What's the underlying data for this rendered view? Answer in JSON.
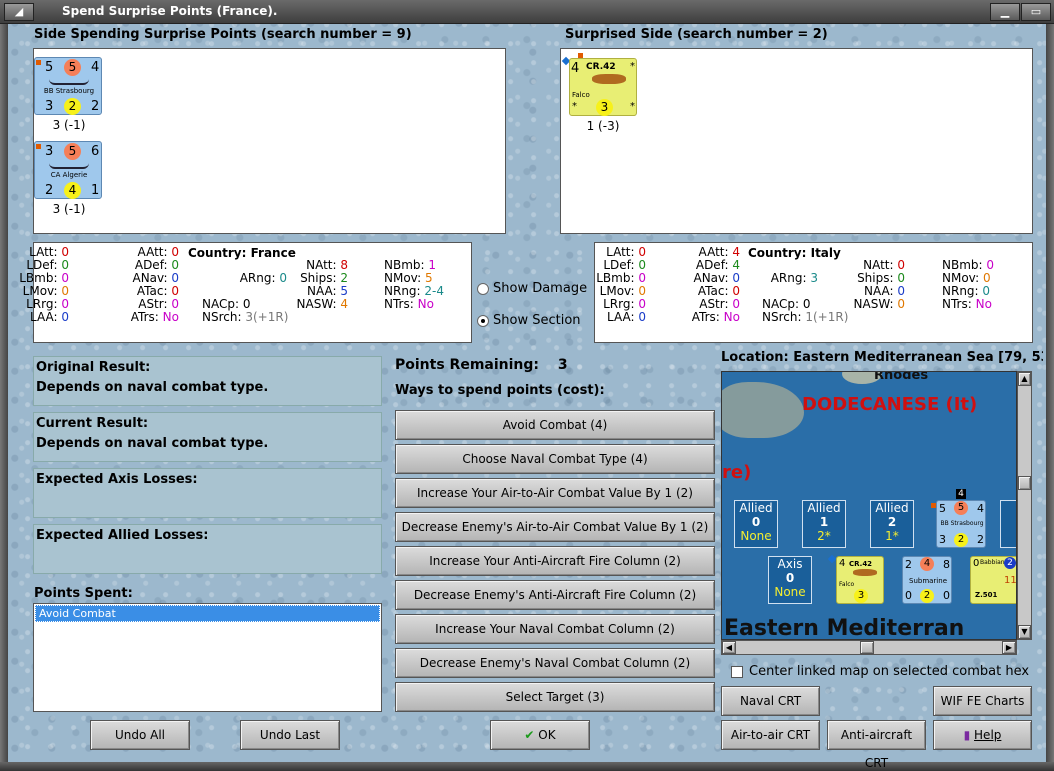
{
  "window": {
    "title": "Spend Surprise Points (France)."
  },
  "spending": {
    "header": "Side Spending Surprise Points (search number = 9)",
    "units": [
      {
        "top_left": "5",
        "top_mid": "5",
        "top_right": "4",
        "name": "BB Strasbourg",
        "bot_left": "3",
        "bot_mid": "2",
        "bot_right": "2",
        "caption": "3 (-1)"
      },
      {
        "top_left": "3",
        "top_mid": "5",
        "top_right": "6",
        "name": "CA Algerie",
        "bot_left": "2",
        "bot_mid": "4",
        "bot_right": "1",
        "caption": "3 (-1)"
      }
    ]
  },
  "surprised": {
    "header": "Surprised Side (search number = 2)",
    "units": [
      {
        "top_left": "4",
        "name": "CR.42",
        "sub": "Falco",
        "star_tr": "*",
        "star_bl": "*",
        "star_br": "*",
        "mid": "3",
        "caption": "1 (-3)"
      }
    ]
  },
  "stats_labels": {
    "latt": "LAtt:",
    "ldef": "LDef:",
    "lbmb": "LBmb:",
    "lmov": "LMov:",
    "lrrg": "LRrg:",
    "laa": "LAA:",
    "aatt": "AAtt:",
    "adef": "ADef:",
    "anav": "ANav:",
    "atac": "ATac:",
    "astr": "AStr:",
    "atrs": "ATrs:",
    "country": "Country:",
    "arng": "ARng:",
    "nacp": "NACp:",
    "nsrch": "NSrch:",
    "natt": "NAtt:",
    "ships": "Ships:",
    "naa": "NAA:",
    "nasw": "NASW:",
    "nbmb": "NBmb:",
    "nmov": "NMov:",
    "nrng": "NRng:",
    "ntrs": "NTrs:"
  },
  "stats_france": {
    "latt": "0",
    "ldef": "0",
    "lbmb": "0",
    "lmov": "0",
    "lrrg": "0",
    "laa": "0",
    "aatt": "0",
    "adef": "0",
    "anav": "0",
    "atac": "0",
    "astr": "0",
    "atrs": "No",
    "country": "France",
    "arng": "0",
    "nacp": "0",
    "nsrch": "3(+1R)",
    "natt": "8",
    "ships": "2",
    "naa": "5",
    "nasw": "4",
    "nbmb": "1",
    "nmov": "5",
    "nrng": "2-4",
    "ntrs": "No"
  },
  "stats_italy": {
    "latt": "0",
    "ldef": "0",
    "lbmb": "0",
    "lmov": "0",
    "lrrg": "0",
    "laa": "0",
    "aatt": "4",
    "adef": "4",
    "anav": "0",
    "atac": "0",
    "astr": "0",
    "atrs": "No",
    "country": "Italy",
    "arng": "3",
    "nacp": "0",
    "nsrch": "1(+1R)",
    "natt": "0",
    "ships": "0",
    "naa": "0",
    "nasw": "0",
    "nbmb": "0",
    "nmov": "0",
    "nrng": "0",
    "ntrs": "No"
  },
  "options": {
    "show_damage": "Show Damage",
    "show_section": "Show Section",
    "selected": "show_section"
  },
  "results": {
    "original_label": "Original Result:",
    "original_value": "Depends on naval combat type.",
    "current_label": "Current Result:",
    "current_value": "Depends on naval combat type.",
    "axis_losses_label": "Expected Axis Losses:",
    "allied_losses_label": "Expected Allied Losses:",
    "points_spent_label": "Points Spent:",
    "points_spent_items": [
      "Avoid Combat"
    ]
  },
  "points": {
    "remaining_label": "Points Remaining:",
    "remaining_value": "3",
    "ways_label": "Ways to spend points (cost):",
    "options": [
      "Avoid Combat (4)",
      "Choose Naval Combat Type (4)",
      "Increase Your Air-to-Air Combat Value By 1 (2)",
      "Decrease Enemy's Air-to-Air Combat Value By 1 (2)",
      "Increase Your Anti-Aircraft Fire Column (2)",
      "Decrease Enemy's Anti-Aircraft Fire Column (2)",
      "Increase Your Naval Combat Column (2)",
      "Decrease Enemy's Naval Combat Column (2)",
      "Select Target (3)"
    ]
  },
  "map": {
    "location": "Location: Eastern Mediterranean Sea [79, 53",
    "place_rhodes": "Rhodes",
    "region": "DODECANESE (It)",
    "fragment": "re)",
    "sea_name": "Eastern Mediterran",
    "cells": [
      {
        "title": "Allied",
        "num": "0",
        "sub": "None"
      },
      {
        "title": "Allied",
        "num": "1",
        "sub": "2*"
      },
      {
        "title": "Allied",
        "num": "2",
        "sub": "1*"
      },
      {
        "title": "Axis",
        "num": "0",
        "sub": "None"
      }
    ],
    "stack_count": "4",
    "map_bb": {
      "tl": "5",
      "tm": "5",
      "tr": "4",
      "name": "BB Strasbourg",
      "bl": "3",
      "bm": "2",
      "br": "2"
    },
    "map_cr": {
      "tl": "4",
      "name": "CR.42",
      "sub": "Falco",
      "mid": "3"
    },
    "map_sub": {
      "tl": "2",
      "tm": "4",
      "tr": "8",
      "name": "Submarine",
      "bl": "0",
      "bm": "2",
      "br": "0"
    },
    "map_z": {
      "tl": "0",
      "name": "Babbiano",
      "code": "Z.501",
      "num": "11",
      "badge": "2"
    },
    "center_checkbox": "Center linked map on selected combat hex"
  },
  "buttons": {
    "undo_all": "Undo All",
    "undo_last": "Undo Last",
    "ok": "OK",
    "naval_crt": "Naval CRT",
    "wif_charts": "WIF FE Charts",
    "air_crt": "Air-to-air CRT",
    "aa_crt": "Anti-aircraft CRT",
    "help": "Help"
  },
  "colors": {
    "unit_blue": "#9fc8ec",
    "unit_yellow": "#e8ee74",
    "sea": "#2a6ea8",
    "panel_blue": "#a9c3d0"
  }
}
